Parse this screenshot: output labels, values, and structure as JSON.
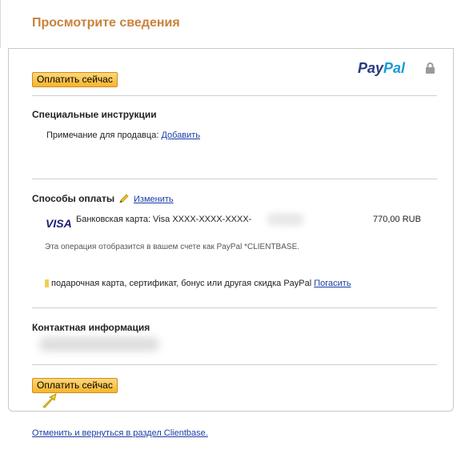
{
  "header": {
    "title": "Просмотрите сведения"
  },
  "logo": {
    "part1": "Pay",
    "part2": "Pal",
    "icon": "lock-icon"
  },
  "buttons": {
    "pay_now_top": "Оплатить сейчас",
    "pay_now_bottom": "Оплатить сейчас"
  },
  "special_instructions": {
    "title": "Специальные инструкции",
    "note_label": "Примечание для продавца:",
    "add_link": "Добавить"
  },
  "payment_methods": {
    "title": "Способы оплаты",
    "edit_icon": "pencil-icon",
    "edit_link": "Изменить",
    "card_brand": "VISA",
    "card_label": "Банковская карта: Visa XXXX-XXXX-XXXX-",
    "amount": "770,00 RUB",
    "statement_note": "Эта операция отобразится в вашем счете как PayPal *CLIENTBASE.",
    "gift_text": "подарочная карта, сертификат, бонус или другая скидка PayPal",
    "redeem_link": "Погасить"
  },
  "contact": {
    "title": "Контактная информация"
  },
  "footer": {
    "cancel_link": "Отменить и вернуться в раздел Clientbase."
  },
  "colors": {
    "header_title": "#c8823a",
    "button_bg": "#f7b52c",
    "link": "#1a3ea8",
    "paypal_dark": "#253b80",
    "paypal_light": "#179bd7"
  }
}
